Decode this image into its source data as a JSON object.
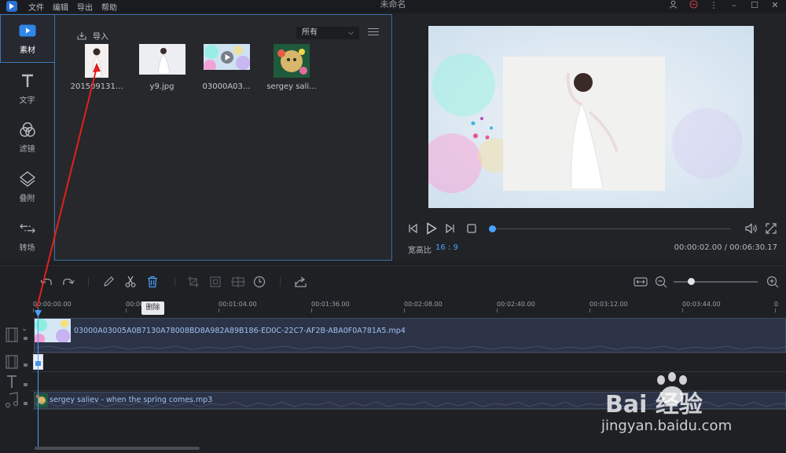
{
  "window": {
    "title": "未命名",
    "menu": [
      "文件",
      "编辑",
      "导出",
      "帮助"
    ]
  },
  "sidebar": {
    "items": [
      {
        "label": "素材",
        "icon": "media-play-icon",
        "active": true
      },
      {
        "label": "文字",
        "icon": "text-t-icon"
      },
      {
        "label": "滤镜",
        "icon": "filter-circles-icon"
      },
      {
        "label": "叠附",
        "icon": "overlay-layers-icon"
      },
      {
        "label": "转场",
        "icon": "transition-arrows-icon"
      }
    ]
  },
  "library": {
    "import_label": "导入",
    "filter_value": "所有",
    "items": [
      {
        "name": "201509131...",
        "kind": "image"
      },
      {
        "name": "y9.jpg",
        "kind": "image"
      },
      {
        "name": "03000A03...",
        "kind": "video"
      },
      {
        "name": "sergey sali...",
        "kind": "audio"
      }
    ]
  },
  "preview": {
    "aspect_label": "宽高比",
    "aspect_value": "16 : 9",
    "timecode": "00:00:02.00 / 00:06:30.17",
    "progress_fraction": 0.005
  },
  "toolbar": {
    "tooltip": "删除",
    "zoom_fraction": 0.17
  },
  "timeline": {
    "ticks": [
      "00:00:00.00",
      "00:00:32.00",
      "00:01:04.00",
      "00:01:36.00",
      "00:02:08.00",
      "00:02:40.00",
      "00:03:12.00",
      "00:03:44.00",
      "0"
    ],
    "video_clip": "03000A03005A0B7130A78008BD8A982A89B186-ED0C-22C7-AF2B-ABA0F0A781A5.mp4",
    "audio_clip": "sergey saliev - when the spring comes.mp3"
  },
  "watermark": {
    "brand": "Bai 经验",
    "url": "jingyan.baidu.com"
  }
}
